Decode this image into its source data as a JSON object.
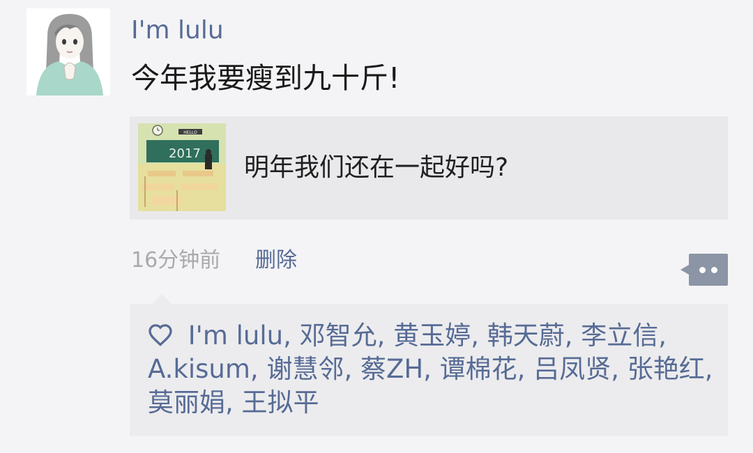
{
  "post": {
    "author": "I'm lulu",
    "text": "今年我要瘦到九十斤!",
    "shared_link": {
      "thumbnail": "classroom-illustration",
      "thumbnail_text": "2017",
      "thumbnail_sign": "HELLO",
      "title": "明年我们还在一起好吗?"
    },
    "time": "16分钟前",
    "delete_label": "删除",
    "more_icon": "comment-more-icon"
  },
  "likes": {
    "icon": "heart-outline-icon",
    "names": [
      "I'm lulu",
      "邓智允",
      "黄玉婷",
      "韩天蔚",
      "李立信",
      "A.kisum",
      "谢慧邻",
      "蔡ZH",
      "谭棉花",
      "吕凤贤",
      "张艳红",
      "莫丽娟",
      "王拟平"
    ],
    "separator": ", "
  },
  "colors": {
    "background": "#f4f4f6",
    "name_link": "#576b95",
    "panel": "#ececee",
    "card": "#e9e9eb",
    "muted": "#a8a8ad",
    "more_button": "#8b95a5"
  }
}
